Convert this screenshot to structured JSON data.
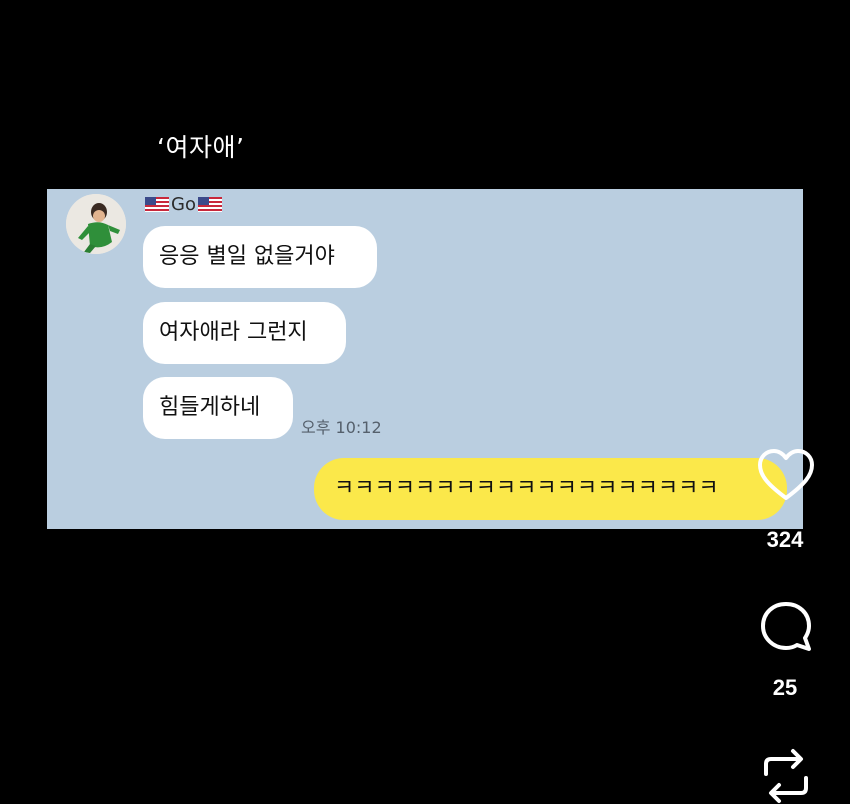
{
  "caption": "‘여자애’",
  "chat": {
    "sender_name": "Go",
    "messages": [
      {
        "from": "other",
        "text": "응응 별일 없을거야"
      },
      {
        "from": "other",
        "text": "여자애라 그런지"
      },
      {
        "from": "other",
        "text": "힘들게하네"
      }
    ],
    "time": "오후 10:12",
    "my_message": "ㅋㅋㅋㅋㅋㅋㅋㅋㅋㅋㅋㅋㅋㅋㅋㅋㅋㅋㅋ"
  },
  "actions": {
    "like": {
      "icon": "heart-icon",
      "count": "324"
    },
    "comment": {
      "icon": "comment-bubble-icon",
      "count": "25"
    },
    "repost": {
      "icon": "repost-icon"
    }
  },
  "colors": {
    "background": "#000000",
    "chat_background": "#bacee0",
    "incoming_bubble": "#ffffff",
    "outgoing_bubble": "#fbe84a"
  }
}
